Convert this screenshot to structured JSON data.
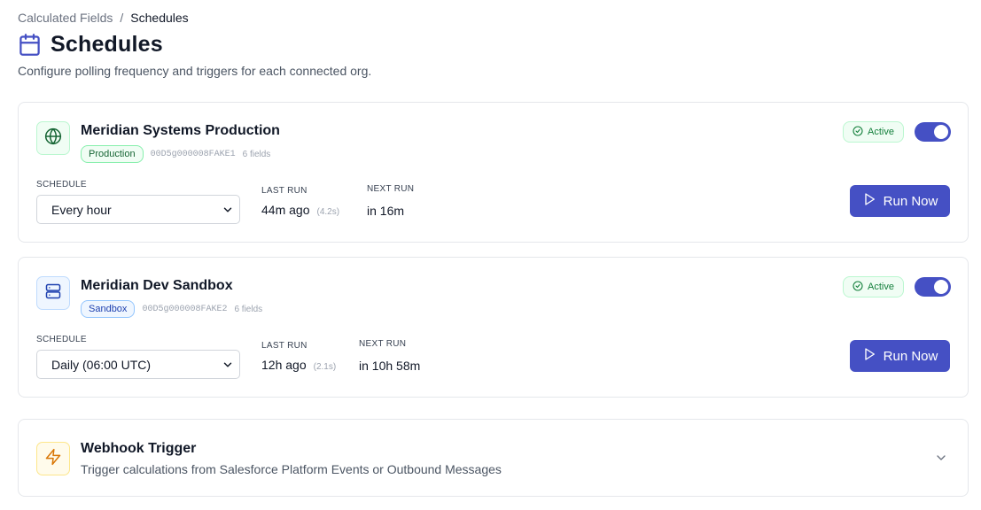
{
  "breadcrumb": {
    "parent": "Calculated Fields",
    "separator": "/",
    "current": "Schedules"
  },
  "page": {
    "title": "Schedules",
    "title_icon": "calendar-icon",
    "subtitle": "Configure polling frequency and triggers for each connected org."
  },
  "labels": {
    "schedule": "SCHEDULE",
    "last_run": "LAST RUN",
    "next_run": "NEXT RUN",
    "run_now": "Run Now"
  },
  "orgs": [
    {
      "name": "Meridian Systems Production",
      "icon": "globe-icon",
      "env_badge": "Production",
      "org_id": "00D5g000008FAKE1",
      "fields": "6 fields",
      "status": "Active",
      "enabled": true,
      "schedule": "Every hour",
      "last_run": "44m ago",
      "last_duration": "(4.2s)",
      "next_run": "in 16m"
    },
    {
      "name": "Meridian Dev Sandbox",
      "icon": "server-icon",
      "env_badge": "Sandbox",
      "org_id": "00D5g000008FAKE2",
      "fields": "6 fields",
      "status": "Active",
      "enabled": true,
      "schedule": "Daily (06:00 UTC)",
      "last_run": "12h ago",
      "last_duration": "(2.1s)",
      "next_run": "in 10h 58m"
    }
  ],
  "webhook": {
    "icon": "lightning-icon",
    "title": "Webhook Trigger",
    "description": "Trigger calculations from Salesforce Platform Events or Outbound Messages"
  },
  "colors": {
    "accent": "#4550c4",
    "success": "#15803d",
    "production_badge": "#166534",
    "sandbox_badge": "#1e40af"
  }
}
